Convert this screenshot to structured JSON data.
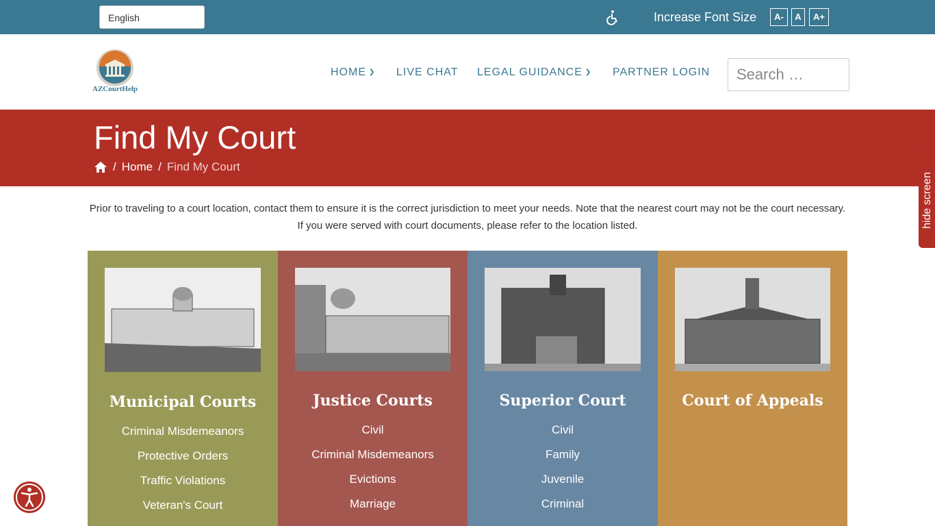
{
  "topbar": {
    "language": "English",
    "font_size_label": "Increase Font Size",
    "font_buttons": [
      "A-",
      "A",
      "A+"
    ]
  },
  "header": {
    "logo_text": "AZCourtHelp",
    "nav": [
      {
        "label": "HOME",
        "has_dropdown": true
      },
      {
        "label": "LIVE CHAT",
        "has_dropdown": false
      },
      {
        "label": "LEGAL GUIDANCE",
        "has_dropdown": true
      },
      {
        "label": "PARTNER LOGIN",
        "has_dropdown": false
      }
    ],
    "search_placeholder": "Search …"
  },
  "banner": {
    "title": "Find My Court",
    "breadcrumb": {
      "home": "Home",
      "separator": "/",
      "current": "Find My Court"
    }
  },
  "intro": "Prior to traveling to a court location, contact them to ensure it is the correct jurisdiction to meet your needs.  Note that the nearest court may not be the court necessary.  If you were served with court documents, please refer to the location listed.",
  "courts": [
    {
      "title": "Municipal Courts",
      "color": "#9a9a58",
      "items": [
        "Criminal Misdemeanors",
        "Protective Orders",
        "Traffic Violations",
        "Veteran's Court"
      ]
    },
    {
      "title": "Justice Courts",
      "color": "#a4574f",
      "items": [
        "Civil",
        "Criminal Misdemeanors",
        "Evictions",
        "Marriage"
      ]
    },
    {
      "title": "Superior Court",
      "color": "#6887a3",
      "items": [
        "Civil",
        "Family",
        "Juvenile",
        "Criminal"
      ]
    },
    {
      "title": "Court of Appeals",
      "color": "#c3914c",
      "items": []
    }
  ],
  "side_tab": "hide screen",
  "colors": {
    "topbar": "#3b7892",
    "banner": "#b22f26",
    "nav": "#3b7892"
  }
}
